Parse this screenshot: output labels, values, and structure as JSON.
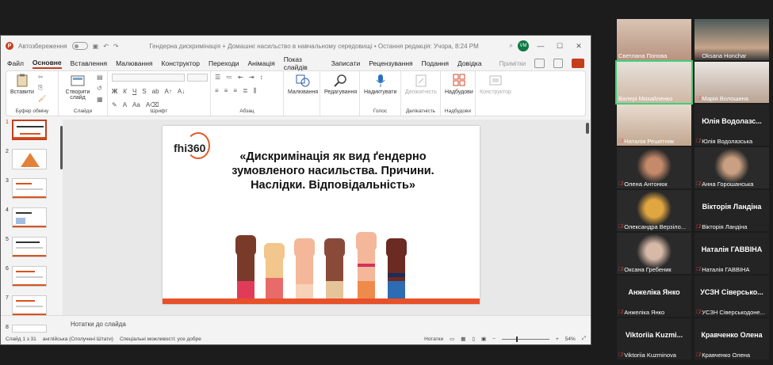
{
  "window": {
    "autosave_label": "Автозбереження",
    "doc_title": "Гендерна дискримінація + Домашнє насильство в навчальному середовищі • Остання редакція: Учора, 8:24 PM",
    "user_initials": "VM"
  },
  "menu": {
    "tabs": [
      "Файл",
      "Основне",
      "Вставлення",
      "Малювання",
      "Конструктор",
      "Переходи",
      "Анімація",
      "Показ слайдів",
      "Записати",
      "Рецензування",
      "Подання",
      "Довідка"
    ],
    "comments_label": "Примітки"
  },
  "ribbon": {
    "paste": "Вставити",
    "clipboard_group": "Буфер обміну",
    "new_slide": "Створити слайд",
    "slides_group": "Слайди",
    "font_group": "Шрифт",
    "paragraph_group": "Абзац",
    "drawing": "Малювання",
    "editing": "Редагування",
    "dictate": "Надиктувати",
    "voice_group": "Голос",
    "sensitivity": "Делікатність",
    "sensitivity_group": "Делікатність",
    "addins": "Надбудови",
    "addins_group": "Надбудови",
    "designer": "Конструктор"
  },
  "slides": {
    "numbers": [
      "1",
      "2",
      "3",
      "4",
      "5",
      "6",
      "7",
      "8"
    ],
    "current_title": "«Дискримінація як вид ґендерно зумовленого насильства. Причини. Наслідки. Відповідальність»",
    "logo_text": "fhi360",
    "notes_placeholder": "Нотатки до слайда"
  },
  "status": {
    "slide_counter": "Слайд 1 з 31",
    "language": "англійська (Сполучені Штати)",
    "accessibility": "Спеціальні можливості: усе добре",
    "notes_button": "Нотатки",
    "zoom": "54%"
  },
  "participants": [
    {
      "name": "Светлана Попова",
      "video": true,
      "muted": false
    },
    {
      "name": "Oksana Honchar",
      "video": true,
      "muted": true
    },
    {
      "name": "Валері Михайленко",
      "video": true,
      "muted": false,
      "speaking": true
    },
    {
      "name": "Марія Волошина",
      "video": true,
      "muted": true
    },
    {
      "name": "Наталія Решетняк",
      "video": true,
      "muted": true
    },
    {
      "name": "Юлія Водолазська",
      "display": "Юлія Водолазс...",
      "video": false,
      "muted": true
    },
    {
      "name": "Олена Антонюк",
      "video": true,
      "muted": true
    },
    {
      "name": "Анна Горошанська",
      "video": true,
      "muted": true
    },
    {
      "name": "Олександра Верзіло...",
      "video": true,
      "muted": true
    },
    {
      "name": "Вікторія Ландіна",
      "display": "Вікторія Ландіна",
      "video": false,
      "muted": true
    },
    {
      "name": "Оксана Гребеник",
      "video": true,
      "muted": true
    },
    {
      "name": "Наталія ГАВВІНА",
      "display": "Наталія ГАВВІНА",
      "video": false,
      "muted": true
    },
    {
      "name": "Анжеліка Янко",
      "display": "Анжеліка Янко",
      "video": false,
      "muted": true
    },
    {
      "name": "УСЗН Сіверськодоне...",
      "display": "УСЗН Сіверсько...",
      "video": false,
      "muted": true
    },
    {
      "name": "Viktoriia Kuzminova",
      "display": "Viktoriia Kuzmi...",
      "video": false,
      "muted": true
    },
    {
      "name": "Кравченко Олена",
      "display": "Кравченко Олена",
      "video": false,
      "muted": true
    }
  ]
}
